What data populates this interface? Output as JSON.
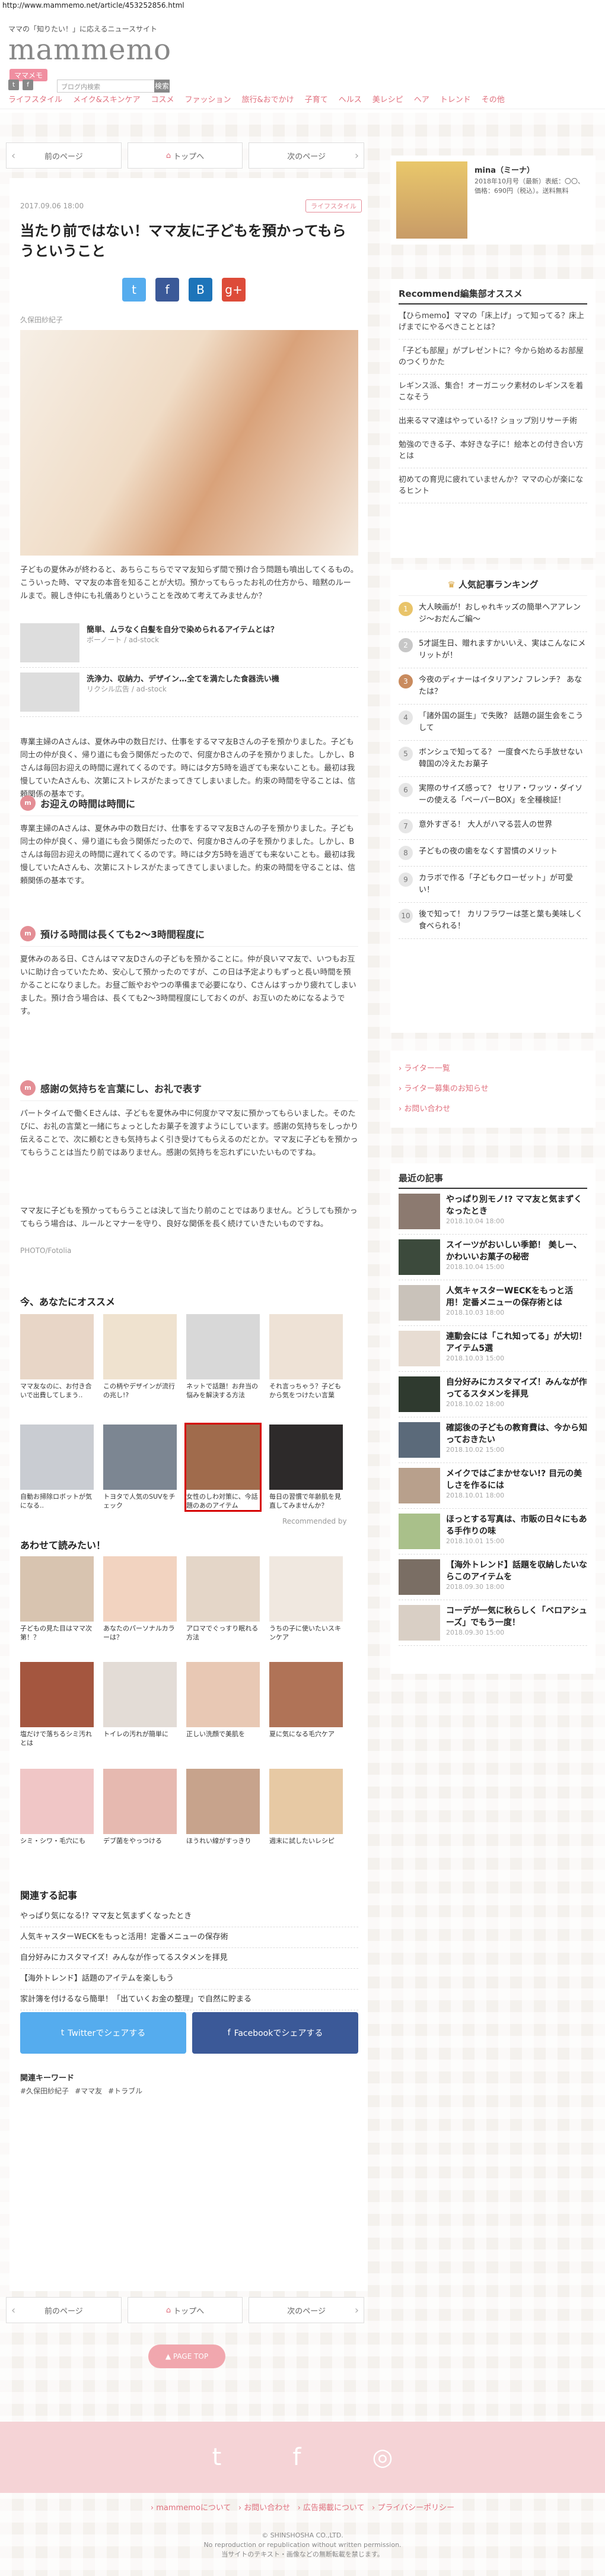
{
  "url": "http://www.mammemo.net/article/453252856.html",
  "header": {
    "tagline": "ママの「知りたい！」に応えるニュースサイト",
    "logo": "mammemo",
    "badge": "ママメモ",
    "search_placeholder": "ブログ内検索",
    "search_button": "検索"
  },
  "nav": [
    "ライフスタイル",
    "メイク&スキンケア",
    "コスメ",
    "ファッション",
    "旅行&おでかけ",
    "子育て",
    "ヘルス",
    "美レシピ",
    "ヘア",
    "トレンド",
    "その他"
  ],
  "pager": {
    "prev": "前のページ",
    "top": "トップへ",
    "next": "次のページ"
  },
  "article": {
    "date": "2017.09.06 18:00",
    "category": "ライフスタイル",
    "title": "当たり前ではない！ママ友に子どもを預かってもらうということ",
    "author": "久保田紗紀子",
    "intro": "子どもの夏休みが終わると、あちらこちらでママ友知らず間で預け合う問題も噴出してくるもの。こういった時、ママ友の本音を知ることが大切。預かってもらったお礼の仕方から、暗黙のルールまで。親しき仲にも礼儀ありということを改めて考えてみませんか？",
    "related1": {
      "title": "簡単、ムラなく白髪を自分で染められるアイテムとは？",
      "source": "ボーノート / ad-stock"
    },
    "related2": {
      "title": "洗浄力、収納力、デザイン…全てを満たした食器洗い機",
      "source": "リクシル広告 / ad-stock"
    },
    "s1_title": "お迎えの時間は時間に",
    "s1_text": "専業主婦のAさんは、夏休み中の数日だけ、仕事をするママ友Bさんの子を預かりました。子ども同士の仲が良く、帰り道にも会う関係だったので、何度かBさんの子を預かりました。しかし、Bさんは毎回お迎えの時間に遅れてくるのです。時には夕方5時を過ぎても来ないことも。最初は我慢していたAさんも、次第にストレスがたまってきてしまいました。約束の時間を守ることは、信頼関係の基本です。",
    "s2_title": "預ける時間は長くても2〜3時間程度に",
    "s2_text": "夏休みのある日、Cさんはママ友Dさんの子どもを預かることに。仲が良いママ友で、いつもお互いに助け合っていたため、安心して預かったのですが、この日は予定よりもずっと長い時間を預かることになりました。お昼ご飯やおやつの準備まで必要になり、Cさんはすっかり疲れてしまいました。預け合う場合は、長くても2〜3時間程度にしておくのが、お互いのためになるようです。",
    "s3_title": "感謝の気持ちを言葉にし、お礼で表す",
    "s3_text": "パートタイムで働くEさんは、子どもを夏休み中に何度かママ友に預かってもらいました。そのたびに、お礼の言葉と一緒にちょっとしたお菓子を渡すようにしています。感謝の気持ちをしっかり伝えることで、次に頼むときも気持ちよく引き受けてもらえるのだとか。ママ友に子どもを預かってもらうことは当たり前ではありません。感謝の気持ちを忘れずにいたいものですね。",
    "closing": "ママ友に子どもを預かってもらうことは決して当たり前のことではありません。どうしても預かってもらう場合は、ルールとマナーを守り、良好な関係を長く続けていきたいものですね。",
    "photo_credit": "PHOTO/Fotolia"
  },
  "recommend": {
    "title": "今、あなたにオススメ",
    "items": [
      "ママ友なのに、お付き合いで出費してしまう..",
      "この柄やデザインが流行の兆し!?",
      "ネットで話題！お弁当の悩みを解決する方法",
      "それ言っちゃう？子どもから気をつけたい言葉",
      "自動お掃除ロボットが気になる..",
      "トヨタで人気のSUVをチェック",
      "女性のしわ対策に、今話題のあのアイテム",
      "毎日の習慣で年齢肌を見直してみませんか？"
    ],
    "source": "Recommended by"
  },
  "ad": {
    "title": "あわせて読みたい！",
    "items": [
      "子どもの見た目はママ次第！？",
      "あなたのパーソナルカラーは？",
      "アロマでぐっすり眠れる方法",
      "うちの子に使いたいスキンケア",
      "塩だけで落ちるシミ汚れとは",
      "トイレの汚れが簡単に",
      "正しい洗顔で美肌を",
      "夏に気になる毛穴ケア",
      "シミ・シワ・毛穴にも",
      "デブ菌をやっつける",
      "ほうれい線がすっきり",
      "週末に試したいレシピ"
    ]
  },
  "related": {
    "title": "関連する記事",
    "items": [
      "やっぱり気になる!? ママ友と気まずくなったとき",
      "人気キャスターWECKをもっと活用！定番メニューの保存術",
      "自分好みにカスタマイズ！みんなが作ってるスタメンを拝見",
      "【海外トレンド】話題のアイテムを楽しもう",
      "家計簿を付けるなら簡単！「出ていくお金の整理」で自然に貯まる"
    ]
  },
  "share": {
    "twitter": "Twitterでシェアする",
    "facebook": "Facebookでシェアする"
  },
  "keywords": {
    "title": "関連キーワード",
    "items": [
      "#久保田紗紀子",
      "#ママ友",
      "#トラブル"
    ]
  },
  "pagetop": "PAGE TOP",
  "sidebar": {
    "ad_title": "mina（ミーナ）",
    "ad_text": "2018年10月号（最新）表紙：〇〇、価格：690円（税込）。送料無料",
    "recommend_title": "Recommend編集部オススメ",
    "recommend_items": [
      "【ひらmemo】ママの「床上げ」って知ってる？床上げまでにやるべきこととは？",
      "「子ども部屋」がプレゼントに？今から始めるお部屋のつくりかた",
      "レギンス派、集合！オーガニック素材のレギンスを着こなそう",
      "出来るママ達はやっている!? ショップ別リサーチ術",
      "勉強のできる子、本好きな子に！絵本との付き合い方とは",
      "初めての育児に疲れていませんか？ママの心が楽になるヒント"
    ],
    "ranking_title": "人気記事ランキング",
    "ranking": [
      "大人映画が！おしゃれキッズの簡単ヘアアレンジ〜おだんご編〜",
      "5才誕生日、贈れますかいいえ、実はこんなにメリットが！",
      "今夜のディナーはイタリアン♪ フレンチ？ あなたは？",
      "「諸外国の誕生」で失敗？ 話題の誕生会をこうして",
      "ボンシュで知ってる？ 一度食べたら手放せない 韓国の冷えたお菓子",
      "実際のサイズ感って？ セリア・ワッツ・ダイソーの使える「ペーパーBOX」を全種検証！",
      "意外すぎる！ 大人がハマる芸人の世界",
      "子どもの夜の歯をなくす習慣のメリット",
      "カラボで作る「子どもクローゼット」が可愛い！",
      "後で知って！ カリフラワーは茎と葉も美味しく食べられる！"
    ],
    "links": [
      "ライター一覧",
      "ライター募集のお知らせ",
      "お問い合わせ"
    ],
    "newest_title": "最近の記事",
    "newest": [
      {
        "title": "やっぱり別モノ!? ママ友と気まずくなったとき",
        "date": "2018.10.04 18:00"
      },
      {
        "title": "スイーツがおいしい季節！ 美しー、かわいいお菓子の秘密",
        "date": "2018.10.04 15:00"
      },
      {
        "title": "人気キャスターWECKをもっと活用！定番メニューの保存術とは",
        "date": "2018.10.03 18:00"
      },
      {
        "title": "連動会には「これ知ってる」が大切！アイテム5選",
        "date": "2018.10.03 15:00"
      },
      {
        "title": "自分好みにカスタマイズ！みんなが作ってるスタメンを拝見",
        "date": "2018.10.02 18:00"
      },
      {
        "title": "確認後の子どもの教育費は、今から知っておきたい",
        "date": "2018.10.02 15:00"
      },
      {
        "title": "メイクではごまかせない!? 目元の美しさを作るには",
        "date": "2018.10.01 18:00"
      },
      {
        "title": "ほっとする写真は、市販の日々にもある手作りの味",
        "date": "2018.10.01 15:00"
      },
      {
        "title": "【海外トレンド】話題を収納したいならこのアイテムを",
        "date": "2018.09.30 18:00"
      },
      {
        "title": "コーデが一気に秋らしく「ベロアシューズ」でもう一度！",
        "date": "2018.09.30 15:00"
      }
    ]
  },
  "footer": {
    "links": [
      "mammemoについて",
      "お問い合わせ",
      "広告掲載について",
      "プライバシーポリシー"
    ],
    "copyright": "© SHINSHOSHA CO.,LTD.",
    "notice": "No reproduction or republication without written permission.",
    "notice2": "当サイトのテキスト・画像などの無断転載を禁じます。"
  }
}
